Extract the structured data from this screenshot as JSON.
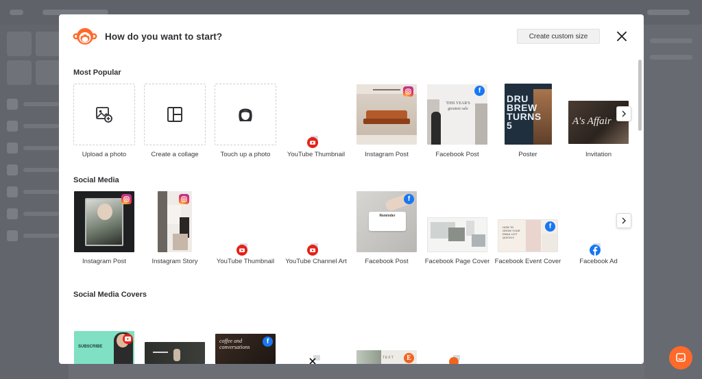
{
  "header": {
    "title": "How do you want to start?",
    "custom_size_label": "Create custom size"
  },
  "sections": {
    "popular": {
      "title": "Most Popular",
      "items": [
        {
          "label": "Upload a photo",
          "icon": "upload-photo-icon"
        },
        {
          "label": "Create a collage",
          "icon": "collage-icon"
        },
        {
          "label": "Touch up a photo",
          "icon": "face-icon"
        },
        {
          "label": "YouTube Thumbnail",
          "icon": "youtube-icon"
        },
        {
          "label": "Instagram Post",
          "icon": "instagram-icon"
        },
        {
          "label": "Facebook Post",
          "icon": "facebook-icon",
          "thumb_text": "THIS YEAR'S greatest sale"
        },
        {
          "label": "Poster",
          "thumb_text": "DRU BREW TURNS 5"
        },
        {
          "label": "Invitation",
          "thumb_text": "A's Affair"
        }
      ]
    },
    "social": {
      "title": "Social Media",
      "items": [
        {
          "label": "Instagram Post",
          "icon": "instagram-icon"
        },
        {
          "label": "Instagram Story",
          "icon": "instagram-icon"
        },
        {
          "label": "YouTube Thumbnail",
          "icon": "youtube-icon"
        },
        {
          "label": "YouTube Channel Art",
          "icon": "youtube-icon"
        },
        {
          "label": "Facebook Post",
          "icon": "facebook-icon",
          "thumb_text": "Reminder"
        },
        {
          "label": "Facebook Page Cover"
        },
        {
          "label": "Facebook Event Cover",
          "icon": "facebook-icon",
          "thumb_text": "HOW TO GROW YOUR EMAIL LIST QUICKLY"
        },
        {
          "label": "Facebook Ad",
          "icon": "facebook-icon"
        }
      ]
    },
    "covers": {
      "title": "Social Media Covers",
      "thumbs": [
        {
          "thumb_text": "SUBSCRIBE",
          "icon": "youtube-icon"
        },
        {
          "thumb_text": ""
        },
        {
          "thumb_text": "coffee and conversations",
          "icon": "facebook-icon"
        },
        {
          "icon": "x-icon"
        },
        {
          "thumb_text": "TEXT",
          "icon": "etsy-icon"
        },
        {
          "icon": "etsy-icon"
        }
      ]
    }
  },
  "colors": {
    "accent": "#ff6a2b",
    "youtube": "#e62117",
    "facebook": "#1877f2",
    "etsy": "#f1641e"
  }
}
